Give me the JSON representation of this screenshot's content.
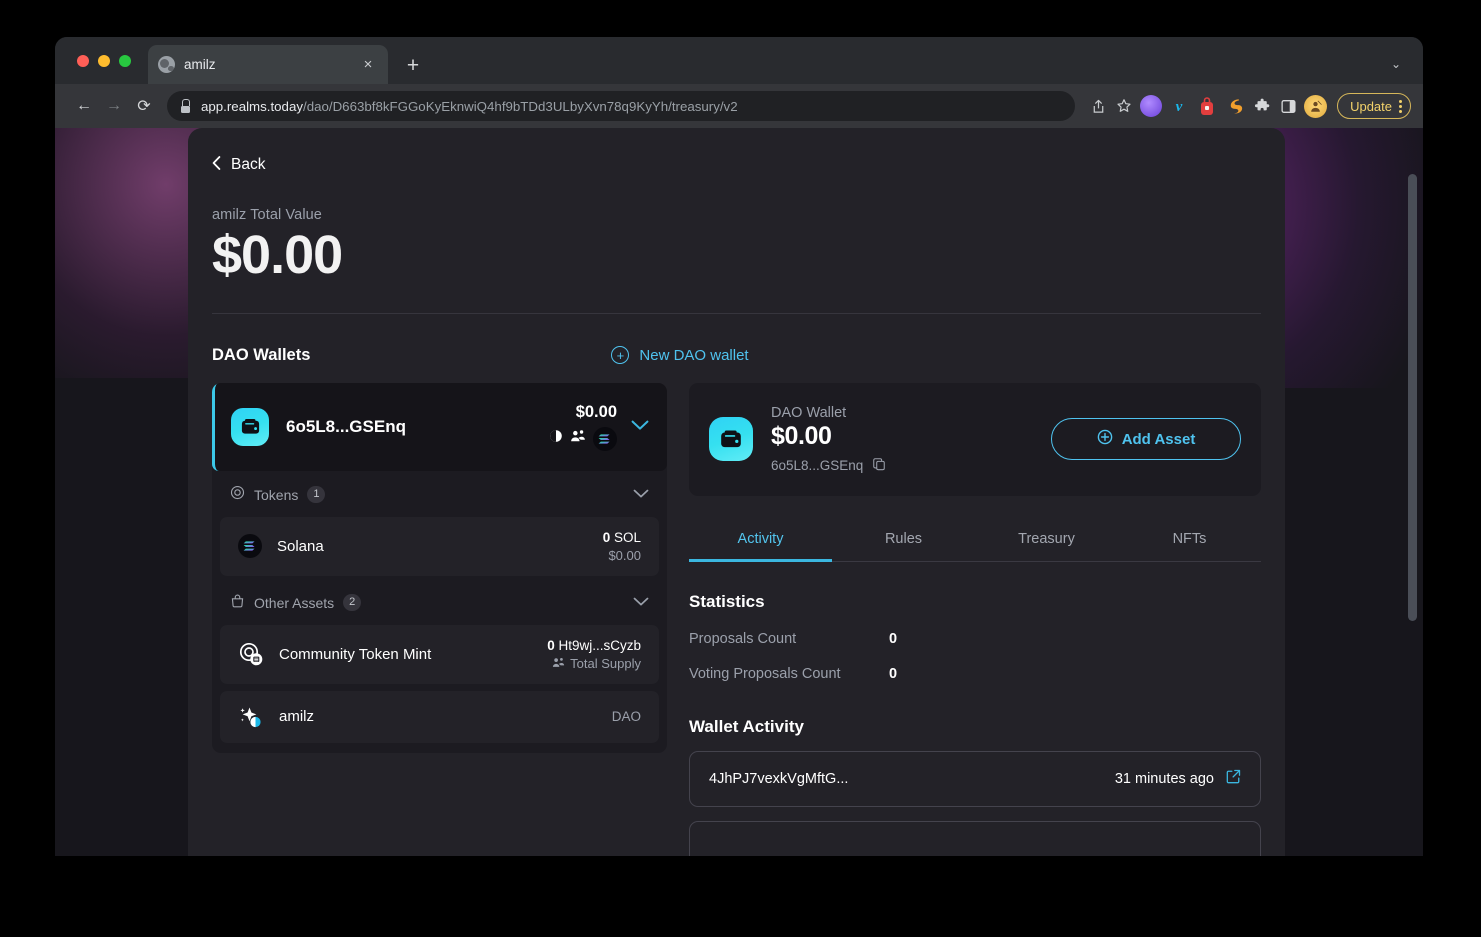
{
  "browser": {
    "tab_title": "amilz",
    "tab_close_label": "×",
    "new_tab_label": "+",
    "window_chevron": "⌄",
    "back_label": "←",
    "forward_label": "→",
    "reload_label": "⟳",
    "url_domain": "app.realms.today",
    "url_path": "/dao/D663bf8kFGGoKyEknwiQ4hf9bTDd3ULbyXvn78q9KyYh/treasury/v2",
    "share_icon": "share-icon",
    "bookmark_icon": "star-icon",
    "extensions": [
      "ghost-extension-icon",
      "vimeo-extension-icon",
      "backpack-extension-icon",
      "solflare-extension-icon",
      "puzzle-extensions-icon",
      "sidepanel-icon"
    ],
    "profile_avatar": "profile-avatar",
    "update_label": "Update",
    "menu_icon": "kebab-menu-icon"
  },
  "page": {
    "back_label": "Back",
    "back_chevron": "‹",
    "total_value_label": "amilz Total Value",
    "total_value": "$0.00",
    "section_title": "DAO Wallets",
    "new_wallet_label": "New DAO wallet",
    "new_wallet_icon": "plus-circle-icon",
    "accent_color": "#4fc3ef",
    "wallet": {
      "address": "6o5L8...GSEnq",
      "value": "$0.00",
      "icon": "wallet-icon",
      "meta_icons": [
        "moon-contrast-icon",
        "community-group-icon",
        "solana-logo-icon"
      ],
      "chevron": "⌄"
    },
    "tokens_group": {
      "label": "Tokens",
      "count": "1",
      "icon": "token-circle-icon",
      "chevron": "⌄",
      "items": [
        {
          "name": "Solana",
          "icon": "solana-logo-icon",
          "amount": "0",
          "unit": "SOL",
          "fiat": "$0.00"
        }
      ]
    },
    "other_assets_group": {
      "label": "Other Assets",
      "count": "2",
      "icon": "bag-icon",
      "chevron": "⌄",
      "items": [
        {
          "name": "Community Token Mint",
          "icon": "mint-token-icon",
          "amount": "0",
          "unit": "Ht9wj...sCyzb",
          "sub": "Total Supply",
          "sub_icon": "supply-icon",
          "tag": ""
        },
        {
          "name": "amilz",
          "icon": "dao-sparkle-icon",
          "tag": "DAO"
        }
      ]
    },
    "detail": {
      "wallet_label": "DAO Wallet",
      "wallet_value": "$0.00",
      "wallet_address": "6o5L8...GSEnq",
      "copy_icon": "copy-icon",
      "add_asset_label": "Add Asset",
      "add_asset_icon": "plus-circle-icon",
      "tabs": [
        {
          "label": "Activity",
          "active": true
        },
        {
          "label": "Rules",
          "active": false
        },
        {
          "label": "Treasury",
          "active": false
        },
        {
          "label": "NFTs",
          "active": false
        }
      ],
      "statistics_title": "Statistics",
      "statistics": [
        {
          "label": "Proposals Count",
          "value": "0"
        },
        {
          "label": "Voting Proposals Count",
          "value": "0"
        }
      ],
      "wallet_activity_title": "Wallet Activity",
      "activity": [
        {
          "hash": "4JhPJ7vexkVgMftG...",
          "time": "31 minutes ago",
          "link_icon": "external-link-icon"
        }
      ]
    }
  }
}
